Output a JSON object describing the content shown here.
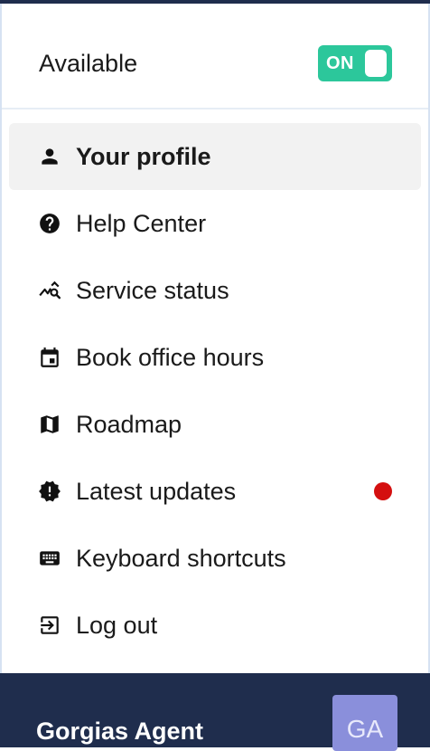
{
  "availability": {
    "label": "Available",
    "toggle_text": "ON",
    "state": "on",
    "accent_color": "#2cc79b"
  },
  "menu": {
    "items": [
      {
        "label": "Your profile",
        "icon": "person-icon",
        "active": true
      },
      {
        "label": "Help Center",
        "icon": "help-circle-icon"
      },
      {
        "label": "Service status",
        "icon": "service-status-icon"
      },
      {
        "label": "Book office hours",
        "icon": "calendar-icon"
      },
      {
        "label": "Roadmap",
        "icon": "map-icon"
      },
      {
        "label": "Latest updates",
        "icon": "new-releases-icon",
        "has_notification": true,
        "notification_color": "#d40f0f"
      },
      {
        "label": "Keyboard shortcuts",
        "icon": "keyboard-icon"
      },
      {
        "label": "Log out",
        "icon": "logout-icon"
      }
    ]
  },
  "footer": {
    "agent_name": "Gorgias Agent",
    "avatar_initials": "GA",
    "background_color": "#1f2d4d",
    "avatar_color": "#8a8fdb"
  }
}
